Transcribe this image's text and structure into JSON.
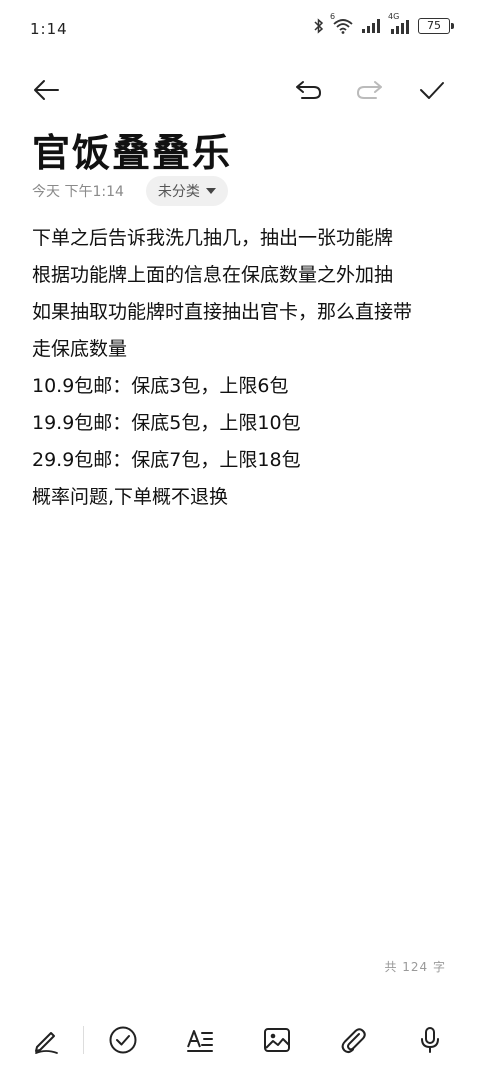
{
  "status_bar": {
    "time": "1:14",
    "network_label": "4G",
    "wifi_badge": "6",
    "battery": "75"
  },
  "toolbar": {
    "back": "back",
    "undo": "undo",
    "redo": "redo",
    "done": "done"
  },
  "note": {
    "title": "官饭叠叠乐",
    "date": "今天 下午1:14",
    "category": "未分类",
    "lines": [
      "下单之后告诉我洗几抽几，抽出一张功能牌",
      "根据功能牌上面的信息在保底数量之外加抽",
      "如果抽取功能牌时直接抽出官卡，那么直接带",
      "走保底数量",
      "10.9包邮：保底3包，上限6包",
      "19.9包邮：保底5包，上限10包",
      "29.9包邮：保底7包，上限18包",
      "概率问题,下单概不退换"
    ],
    "word_count": "共 124 字"
  },
  "bottom_tools": [
    "pen-icon",
    "checklist-icon",
    "text-format-icon",
    "image-icon",
    "attachment-icon",
    "microphone-icon"
  ]
}
